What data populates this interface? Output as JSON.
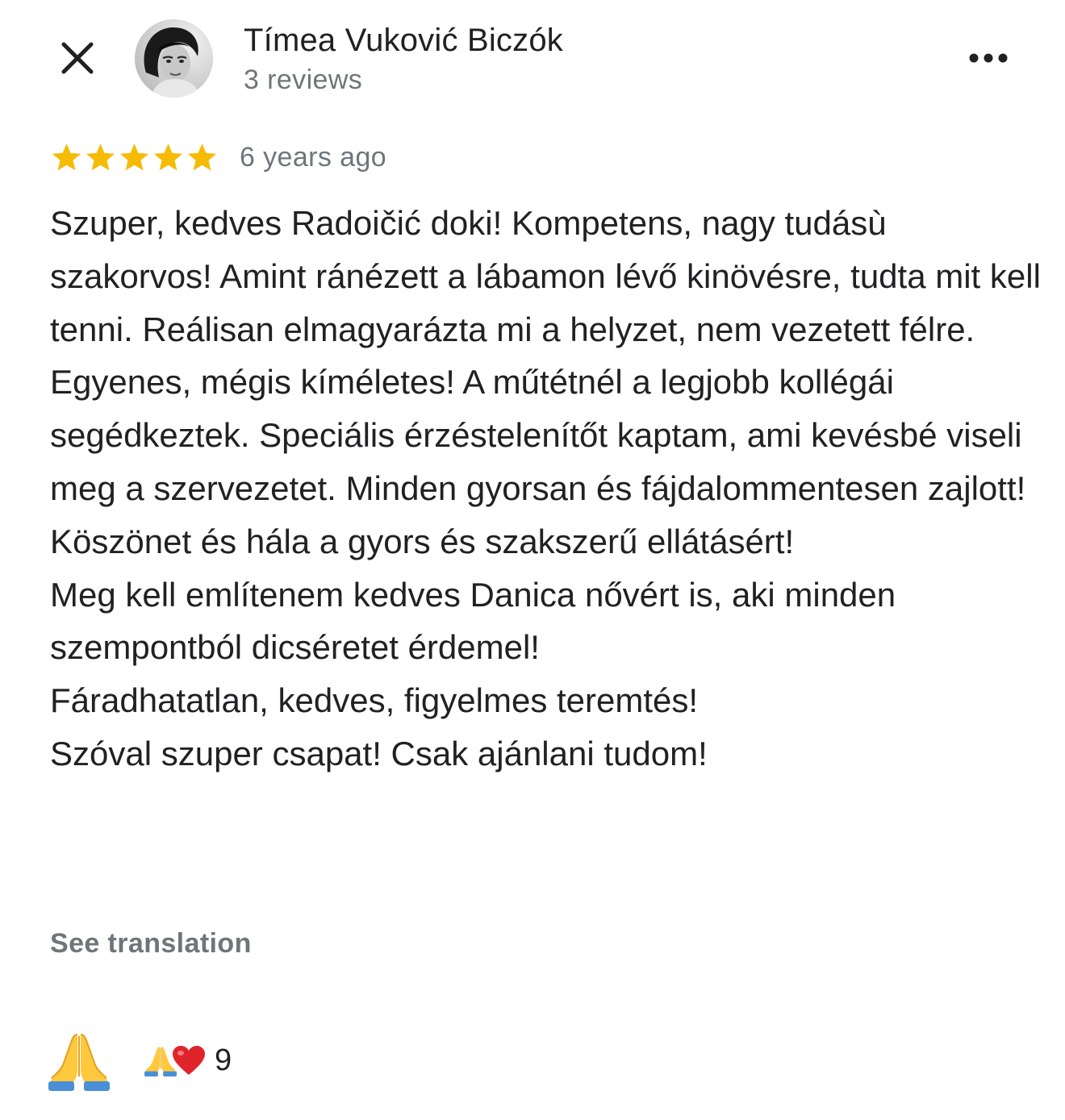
{
  "header": {
    "reviewer_name": "Tímea Vuković Biczók",
    "review_count": "3 reviews",
    "close_icon": "close-icon",
    "more_icon": "more-horizontal-icon"
  },
  "review": {
    "rating": 5,
    "max_rating": 5,
    "time_ago": "6 years ago",
    "text": "Szuper, kedves Radoičić doki! Kompetens, nagy tudásù szakorvos! Amint ránézett a lábamon lévő kinövésre, tudta mit kell tenni. Reálisan elmagyarázta mi a helyzet, nem vezetett félre. Egyenes, mégis kíméletes! A műtétnél a legjobb kollégái segédkeztek. Speciális érzéstelenítőt kaptam, ami kevésbé viseli meg a szervezetet. Minden gyorsan és fájdalommentesen zajlott!\nKöszönet és hála a gyors és szakszerű ellátásért!\nMeg kell említenem kedves Danica nővért is, aki minden szempontból dicséretet érdemel!\nFáradhatatlan, kedves, figyelmes teremtés!\nSzóval szuper csapat! Csak ajánlani tudom!",
    "see_translation": "See translation"
  },
  "reactions": {
    "react_icon": "folded-hands-icon",
    "summary_icons": [
      "folded-hands-icon",
      "heart-icon"
    ],
    "count": "9"
  },
  "colors": {
    "star": "#F6BB06",
    "secondary_text": "#70757A",
    "primary_text": "#202124",
    "heart": "#E0242B",
    "hands": "#FFC83D"
  }
}
